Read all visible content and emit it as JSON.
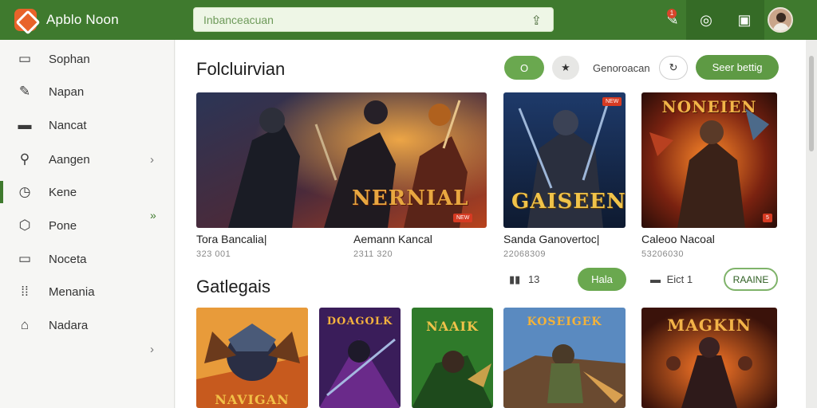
{
  "app": {
    "title": "Apblo Noon",
    "search_placeholder": "Inbanceacuan"
  },
  "topbar": {
    "badge": "1"
  },
  "sidebar": {
    "items": [
      {
        "label": "Sophan",
        "icon": "folder-icon"
      },
      {
        "label": "Napan",
        "icon": "pen-icon"
      },
      {
        "label": "Nancat",
        "icon": "window-icon"
      },
      {
        "label": "Aangen",
        "icon": "search-icon"
      },
      {
        "label": "Kene",
        "icon": "clock-icon"
      },
      {
        "label": "Pone",
        "icon": "shield-icon"
      },
      {
        "label": "Noceta",
        "icon": "panel-icon"
      },
      {
        "label": "Menania",
        "icon": "grid-icon"
      },
      {
        "label": "Nadara",
        "icon": "tag-icon"
      }
    ]
  },
  "featured": {
    "title": "Folcluirvian",
    "btn_primary": "O",
    "btn_star": "★",
    "filter_label": "Genoroacan",
    "btn_see": "Seer bettig",
    "cards": [
      {
        "caption": "Tora Bancalia|",
        "sub": "323 001",
        "art_title": "NERNIAL",
        "tag": "NEW"
      },
      {
        "caption": "Aemann Kancal",
        "sub": "2311 320",
        "art_title": "",
        "tag": ""
      },
      {
        "caption": "Sanda Ganovertoc|",
        "sub": "22068309",
        "art_title": "GAISEEN",
        "tag": "NEW"
      },
      {
        "caption": "Caleoo Nacoal",
        "sub": "53206030",
        "art_title": "NONEIEN",
        "tag": "5"
      }
    ]
  },
  "categories": {
    "title": "Gatlegais",
    "count": "13",
    "btn_primary": "Hala",
    "stat2": "Eict 1",
    "btn_outline": "RAAINE",
    "tiles": [
      {
        "art_title": "NAVIGAN"
      },
      {
        "art_title": "DOAGOLK"
      },
      {
        "art_title": "NAAIK"
      },
      {
        "art_title": "KOSEIGEK"
      },
      {
        "art_title": "MAGKIN"
      }
    ]
  }
}
